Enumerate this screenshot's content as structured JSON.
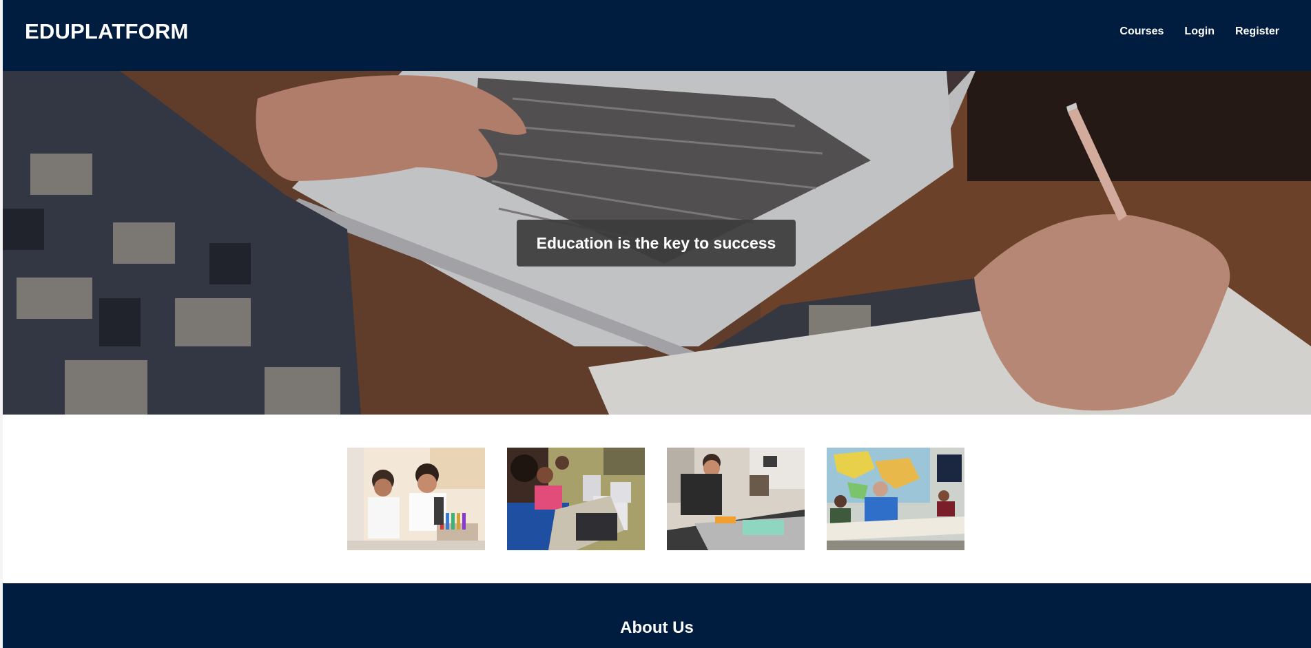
{
  "header": {
    "brand": "EDUPLATFORM",
    "nav": [
      {
        "label": "Courses"
      },
      {
        "label": "Login"
      },
      {
        "label": "Register"
      }
    ],
    "background": "#001c3f"
  },
  "hero": {
    "caption": "Education is the key to success",
    "image": "student-typing-laptop-and-writing"
  },
  "gallery": {
    "images": [
      {
        "subject": "students-with-microscope-lab"
      },
      {
        "subject": "students-on-laptops-classroom"
      },
      {
        "subject": "student-building-model-workshop"
      },
      {
        "subject": "students-in-classroom-world-map"
      }
    ]
  },
  "footer": {
    "title": "About Us"
  },
  "colors": {
    "navy": "#001c3f",
    "caption_bg": "#3c3c3c",
    "text_light": "#ffffff"
  }
}
